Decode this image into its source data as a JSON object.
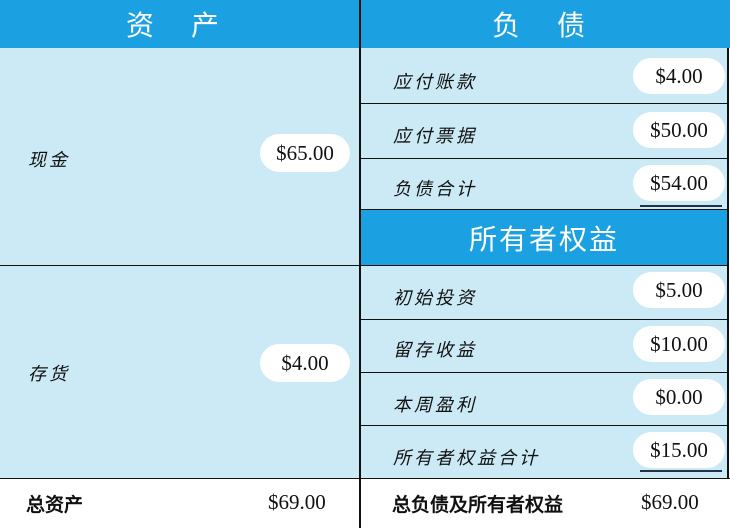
{
  "headers": {
    "assets": "资 产",
    "liabilities": "负 债",
    "equity": "所有者权益"
  },
  "assets": [
    {
      "label": "现金",
      "value": "$65.00"
    },
    {
      "label": "存货",
      "value": "$4.00"
    }
  ],
  "liabilities": [
    {
      "label": "应付账款",
      "value": "$4.00"
    },
    {
      "label": "应付票据",
      "value": "$50.00"
    },
    {
      "label": "负债合计",
      "value": "$54.00"
    }
  ],
  "equity": [
    {
      "label": "初始投资",
      "value": "$5.00"
    },
    {
      "label": "留存收益",
      "value": "$10.00"
    },
    {
      "label": "本周盈利",
      "value": "$0.00"
    },
    {
      "label": "所有者权益合计",
      "value": "$15.00"
    }
  ],
  "totals": {
    "assets_label": "总资产",
    "assets_value": "$69.00",
    "liab_equity_label": "总负债及所有者权益",
    "liab_equity_value": "$69.00"
  }
}
